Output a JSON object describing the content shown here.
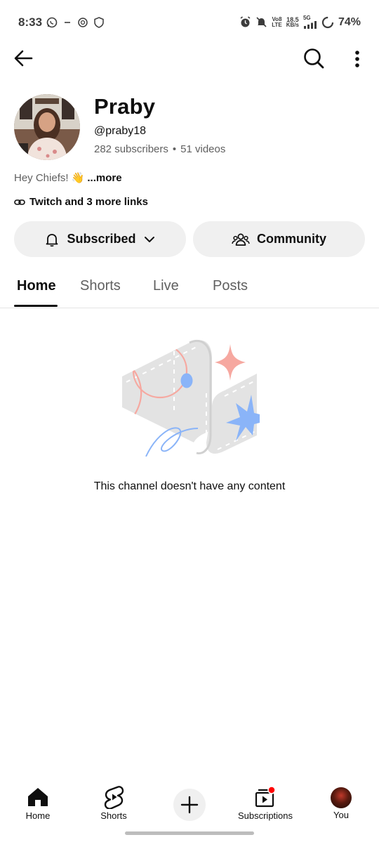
{
  "status_bar": {
    "time": "8:33",
    "net_top": "Vo8",
    "net_bottom": "LTE",
    "speed_top": "18.5",
    "speed_bottom": "KB/s",
    "signal_label": "5G",
    "battery": "74%"
  },
  "channel": {
    "name": "Praby",
    "handle": "@praby18",
    "subscribers": "282 subscribers",
    "videos": "51 videos",
    "separator": "•",
    "description": "Hey Chiefs! 👋",
    "description_more": "...more",
    "links": "Twitch and 3 more links"
  },
  "actions": {
    "subscribed_label": "Subscribed",
    "community_label": "Community"
  },
  "tabs": [
    {
      "label": "Home",
      "active": true
    },
    {
      "label": "Shorts",
      "active": false
    },
    {
      "label": "Live",
      "active": false
    },
    {
      "label": "Posts",
      "active": false
    }
  ],
  "empty_state": {
    "message": "This channel doesn't have any content"
  },
  "bottom_nav": {
    "home": "Home",
    "shorts": "Shorts",
    "subscriptions": "Subscriptions",
    "you": "You"
  },
  "colors": {
    "text_primary": "#0f0f0f",
    "text_secondary": "#606060",
    "pill_bg": "#f0f0f0",
    "notification_dot": "#ff0000",
    "illustration_blue": "#8ab4f8",
    "illustration_pink": "#f6a8a0"
  }
}
